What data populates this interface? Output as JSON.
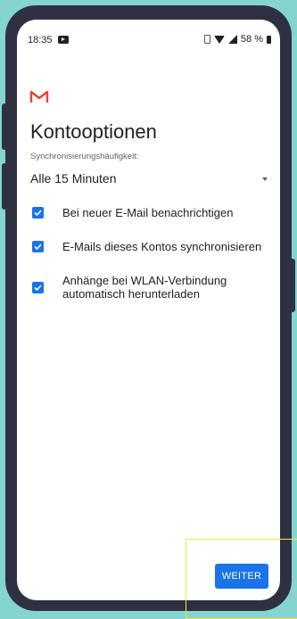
{
  "status_bar": {
    "time": "18:35",
    "battery": "58 %"
  },
  "header": {
    "title": "Kontooptionen"
  },
  "sync": {
    "label": "Synchronisierungshäufigkeit:",
    "value": "Alle 15 Minuten"
  },
  "options": [
    {
      "label": "Bei neuer E-Mail benachrichtigen",
      "checked": true
    },
    {
      "label": "E-Mails dieses Kontos synchronisieren",
      "checked": true
    },
    {
      "label": "Anhänge bei WLAN-Verbindung automatisch herunterladen",
      "checked": true
    }
  ],
  "footer": {
    "next_label": "WEITER"
  },
  "colors": {
    "accent": "#1a73e8",
    "gmail_red": "#ea4335",
    "background": "#84d5cf",
    "highlight": "#f5e642"
  }
}
